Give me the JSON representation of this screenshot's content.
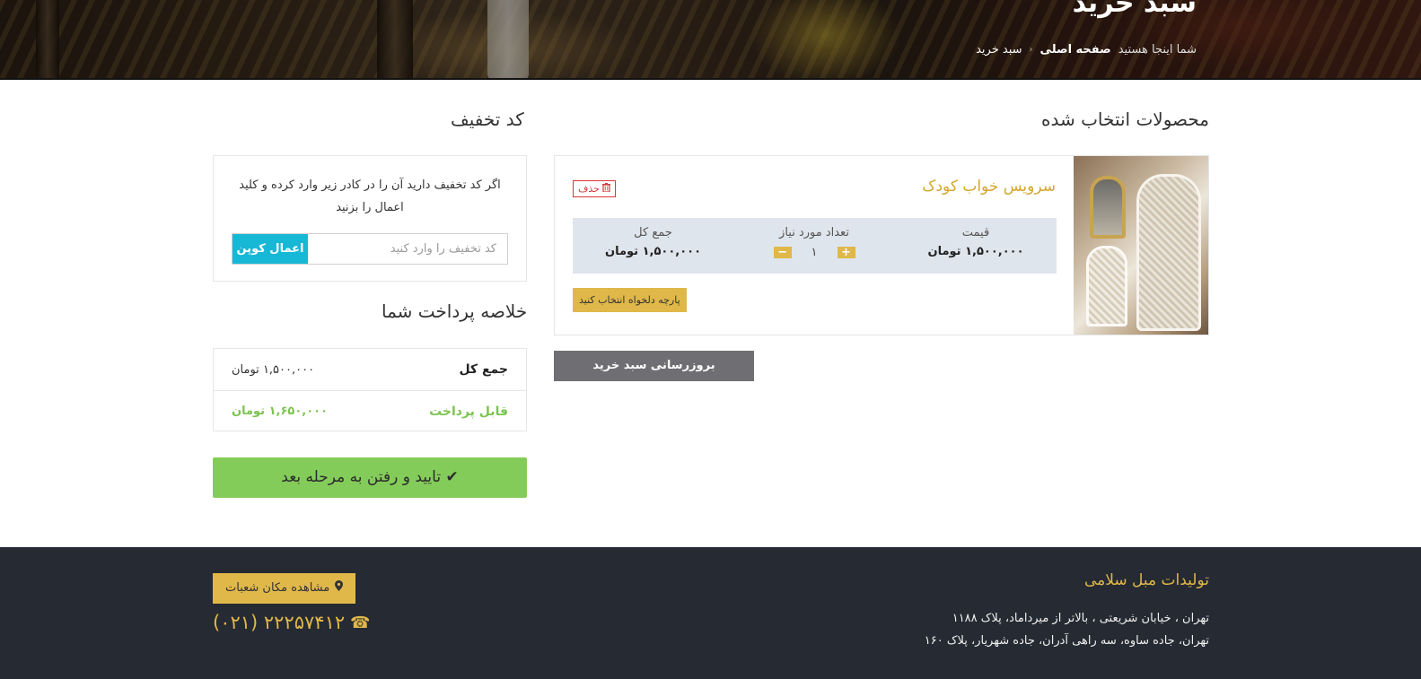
{
  "hero": {
    "title": "سبد خرید",
    "breadcrumb": {
      "prefix": "شما اینجا هستید",
      "home": "صفحه اصلی",
      "current": "سبد خرید"
    }
  },
  "cart": {
    "heading": "محصولات انتخاب شده",
    "item": {
      "name": "سرویس خواب کودک",
      "delete_label": "حذف",
      "price_label": "قیمت",
      "price_value": "۱,۵۰۰,۰۰۰ تومان",
      "qty_label": "تعداد مورد نیاز",
      "qty_value": "۱",
      "qty_plus": "+",
      "qty_minus": "−",
      "total_label": "جمع کل",
      "total_value": "۱,۵۰۰,۰۰۰ تومان",
      "fabric_button": "پارچه دلخواه انتخاب کنید"
    },
    "update_button": "بروزرسانی سبد خرید"
  },
  "coupon": {
    "heading": "کد تخفیف",
    "description": "اگر کد تخفیف دارید آن را در کادر زیر وارد کرده و کلید اعمال را بزنید",
    "placeholder": "کد تخفیف را وارد کنید",
    "value": "",
    "apply_button": "اعمال کوپن"
  },
  "summary": {
    "heading": "خلاصه پرداخت شما",
    "total_label": "جمع کل",
    "total_value": "۱,۵۰۰,۰۰۰ تومان",
    "payable_label": "قابل پرداخت",
    "payable_value": "۱,۶۵۰,۰۰۰ تومان"
  },
  "confirm_button": "تایید و رفتن به مرحله بعد",
  "footer": {
    "title": "تولیدات مبل سلامی",
    "address_1": "تهران ، خیابان شریعتی ، بالاتر از میرداماد، پلاک ۱۱۸۸",
    "address_2": "تهران، جاده ساوه، سه راهی آدران، جاده شهریار، پلاک ۱۶۰",
    "branches_button": "مشاهده مکان شعبات",
    "phone": "(۰۲۱) ۲۲۲۵۷۴۱۲"
  },
  "colors": {
    "accent_gold": "#e0b84a",
    "coupon_blue": "#17b8d6",
    "success_green": "#84cc5a",
    "payable_green": "#7dc352",
    "delete_red": "#d8363a",
    "footer_bg": "#262a33"
  },
  "icons": {
    "delete": "trash-icon",
    "confirm": "check-icon",
    "branches": "map-marker-icon",
    "phone": "phone-icon"
  }
}
